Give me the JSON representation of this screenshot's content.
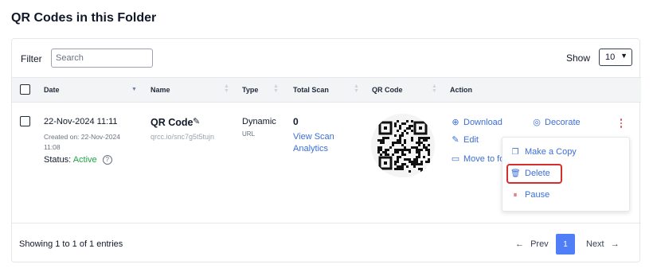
{
  "page": {
    "title": "QR Codes in this Folder"
  },
  "toolbar": {
    "filter_label": "Filter",
    "search_placeholder": "Search",
    "show_label": "Show",
    "show_value": "10"
  },
  "table": {
    "headers": [
      "Date",
      "Name",
      "Type",
      "Total Scan",
      "QR Code",
      "Action"
    ],
    "row": {
      "date": "22-Nov-2024 11:11",
      "created_on": "Created on: 22-Nov-2024",
      "created_time": "11:08",
      "status_label": "Status:",
      "status_value": "Active",
      "name": "QR Code",
      "url": "qrcc.io/snc7g5t5tujn",
      "type": "Dynamic",
      "type_sub": "URL",
      "total_scan": "0",
      "view_analytics_line1": "View Scan",
      "view_analytics_line2": "Analytics"
    },
    "actions": {
      "download": "Download",
      "decorate": "Decorate",
      "edit": "Edit",
      "move": "Move to fo"
    },
    "menu": {
      "make_copy": "Make a Copy",
      "delete": "Delete",
      "pause": "Pause"
    }
  },
  "footer": {
    "entries": "Showing 1 to 1 of 1 entries",
    "prev": "Prev",
    "page": "1",
    "next": "Next"
  },
  "colors": {
    "accent": "#3b6fd8",
    "active_status": "#22a447",
    "page_button": "#4f7ef7",
    "highlight": "#d62d2d"
  }
}
